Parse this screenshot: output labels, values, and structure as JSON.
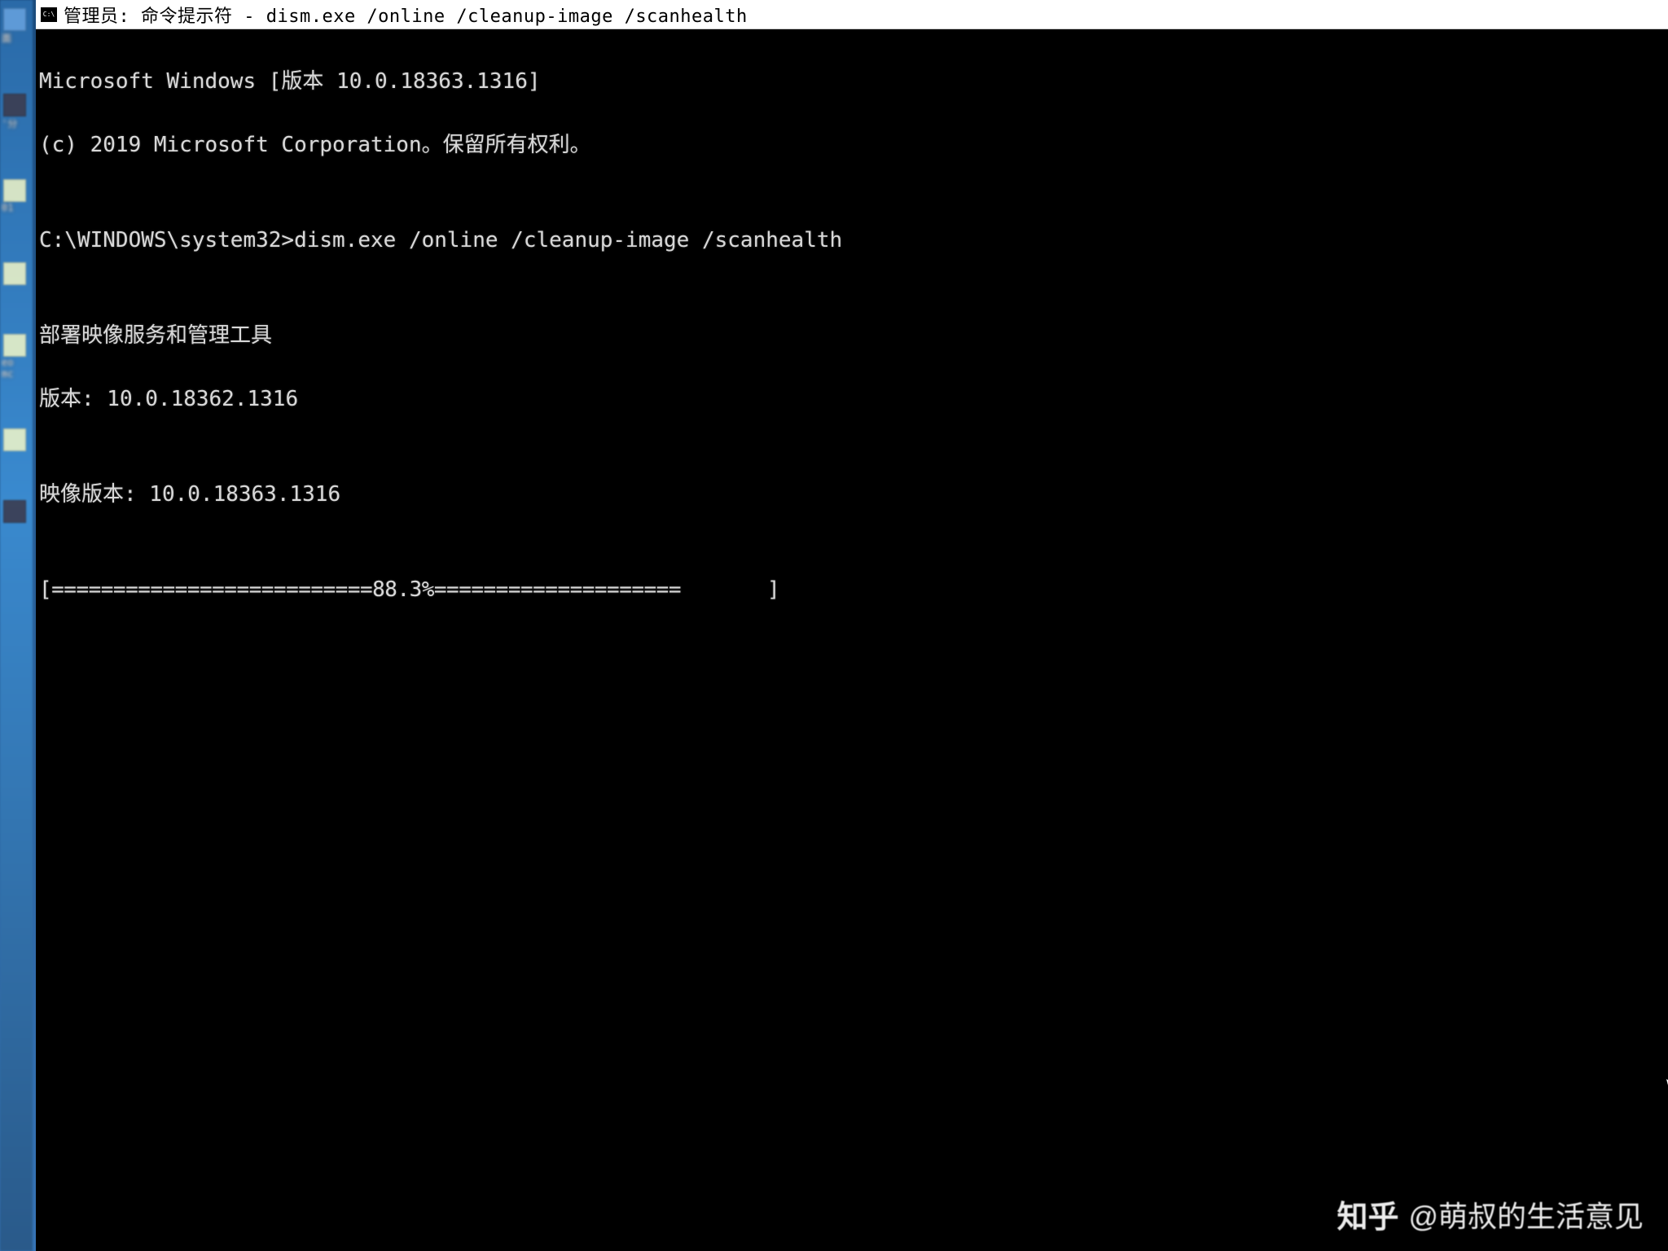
{
  "titlebar": {
    "icon_label": "C:\\",
    "title": "管理员: 命令提示符 - dism.exe  /online /cleanup-image /scanhealth"
  },
  "terminal": {
    "line1": "Microsoft Windows [版本 10.0.18363.1316]",
    "line2": "(c) 2019 Microsoft Corporation。保留所有权利。",
    "blank1": "",
    "prompt_line": "C:\\WINDOWS\\system32>dism.exe /online /cleanup-image /scanhealth",
    "blank2": "",
    "tool_name": "部署映像服务和管理工具",
    "tool_version": "版本: 10.0.18362.1316",
    "blank3": "",
    "image_version": "映像版本: 10.0.18363.1316",
    "blank4": "",
    "progress": "[==========================88.3%====================       ]"
  },
  "desktop_sidebar": {
    "label1": "面",
    "label2": "'分",
    "label3": "01",
    "label4": "eo",
    "label5": "mc"
  },
  "watermark": {
    "logo": "知乎",
    "author": "@萌叔的生活意见"
  }
}
